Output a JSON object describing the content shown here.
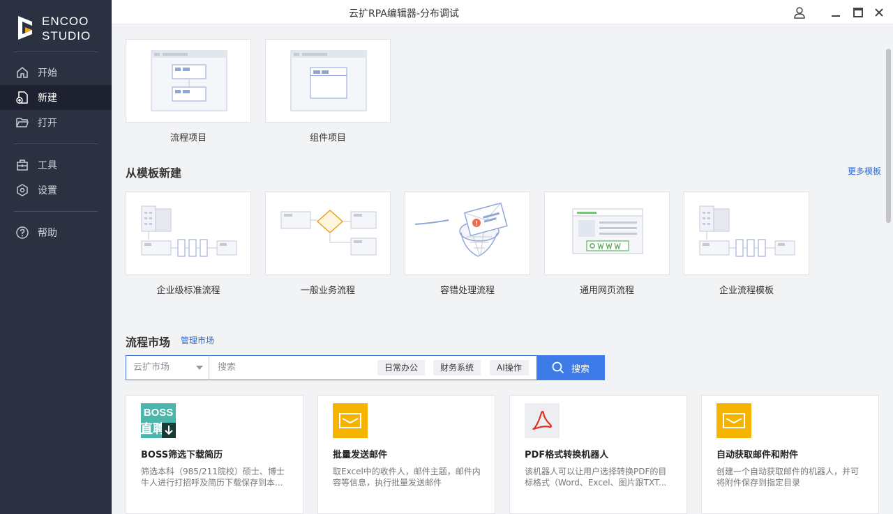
{
  "app": {
    "brand_line1": "ENCOO",
    "brand_line2": "STUDIO",
    "title": "云扩RPA编辑器-分布调试"
  },
  "sidebar": {
    "items": [
      {
        "label": "开始",
        "icon": "home-icon"
      },
      {
        "label": "新建",
        "icon": "new-file-icon",
        "active": true
      },
      {
        "label": "打开",
        "icon": "folder-open-icon"
      },
      {
        "label": "工具",
        "icon": "toolbox-icon"
      },
      {
        "label": "设置",
        "icon": "settings-icon"
      },
      {
        "label": "帮助",
        "icon": "help-icon"
      }
    ]
  },
  "new_project": {
    "cards": [
      {
        "label": "流程项目",
        "icon": "flow-project-icon"
      },
      {
        "label": "组件项目",
        "icon": "component-project-icon"
      }
    ]
  },
  "templates": {
    "title": "从模板新建",
    "more_link": "更多模板",
    "cards": [
      {
        "label": "企业级标准流程",
        "icon": "enterprise-flow-icon"
      },
      {
        "label": "一般业务流程",
        "icon": "business-flow-icon"
      },
      {
        "label": "容错处理流程",
        "icon": "error-handling-icon"
      },
      {
        "label": "通用网页流程",
        "icon": "web-flow-icon"
      },
      {
        "label": "企业流程模板",
        "icon": "enterprise-template-icon"
      }
    ]
  },
  "market": {
    "title": "流程市场",
    "manage_link": "管理市场",
    "source_select": "云扩市场",
    "search_placeholder": "搜索",
    "tags": [
      "日常办公",
      "财务系统",
      "AI操作"
    ],
    "search_button": "搜索",
    "cards": [
      {
        "title": "BOSS筛选下载简历",
        "desc": "筛选本科（985/211院校）硕士、博士牛人进行打招呼及简历下载保存到本...",
        "icon": "boss-zhipin-icon",
        "icon_text": "BOSS",
        "icon_text2": "直聘"
      },
      {
        "title": "批量发送邮件",
        "desc": "取Excel中的收件人，邮件主题，邮件内容等信息，执行批量发送邮件",
        "icon": "mail-icon"
      },
      {
        "title": "PDF格式转换机器人",
        "desc": "该机器人可以让用户选择转换PDF的目标格式（Word、Excel、图片跟TXT...",
        "icon": "pdf-icon"
      },
      {
        "title": "自动获取邮件和附件",
        "desc": "创建一个自动获取邮件的机器人，并可将附件保存到指定目录",
        "icon": "mail-icon"
      }
    ]
  },
  "colors": {
    "sidebar_bg": "#2c3142",
    "accent": "#3d7be8",
    "brand_orange": "#f5a623"
  }
}
